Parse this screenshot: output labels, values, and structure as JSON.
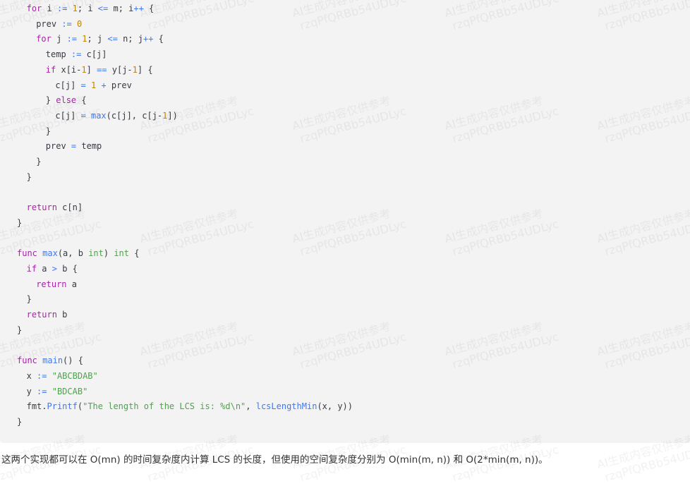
{
  "code": {
    "language": "go",
    "lines": [
      {
        "indent": 1,
        "tokens": [
          [
            "kw",
            "for"
          ],
          [
            "plain",
            " i "
          ],
          [
            "op",
            ":="
          ],
          [
            "plain",
            " "
          ],
          [
            "num",
            "1"
          ],
          [
            "plain",
            "; i "
          ],
          [
            "op",
            "<="
          ],
          [
            "plain",
            " m; i"
          ],
          [
            "op",
            "++"
          ],
          [
            "plain",
            " {"
          ]
        ]
      },
      {
        "indent": 2,
        "tokens": [
          [
            "plain",
            "prev "
          ],
          [
            "op",
            ":="
          ],
          [
            "plain",
            " "
          ],
          [
            "num",
            "0"
          ]
        ]
      },
      {
        "indent": 2,
        "tokens": [
          [
            "kw",
            "for"
          ],
          [
            "plain",
            " j "
          ],
          [
            "op",
            ":="
          ],
          [
            "plain",
            " "
          ],
          [
            "num",
            "1"
          ],
          [
            "plain",
            "; j "
          ],
          [
            "op",
            "<="
          ],
          [
            "plain",
            " n; j"
          ],
          [
            "op",
            "++"
          ],
          [
            "plain",
            " {"
          ]
        ]
      },
      {
        "indent": 3,
        "tokens": [
          [
            "plain",
            "temp "
          ],
          [
            "op",
            ":="
          ],
          [
            "plain",
            " c[j]"
          ]
        ]
      },
      {
        "indent": 3,
        "tokens": [
          [
            "kw",
            "if"
          ],
          [
            "plain",
            " x[i-"
          ],
          [
            "num",
            "1"
          ],
          [
            "plain",
            "] "
          ],
          [
            "op",
            "=="
          ],
          [
            "plain",
            " y[j-"
          ],
          [
            "num",
            "1"
          ],
          [
            "plain",
            "] {"
          ]
        ]
      },
      {
        "indent": 4,
        "tokens": [
          [
            "plain",
            "c[j] "
          ],
          [
            "op",
            "="
          ],
          [
            "plain",
            " "
          ],
          [
            "num",
            "1"
          ],
          [
            "plain",
            " "
          ],
          [
            "op",
            "+"
          ],
          [
            "plain",
            " prev"
          ]
        ]
      },
      {
        "indent": 3,
        "tokens": [
          [
            "plain",
            "} "
          ],
          [
            "kw",
            "else"
          ],
          [
            "plain",
            " {"
          ]
        ]
      },
      {
        "indent": 4,
        "tokens": [
          [
            "plain",
            "c[j] "
          ],
          [
            "op",
            "="
          ],
          [
            "plain",
            " "
          ],
          [
            "fn",
            "max"
          ],
          [
            "plain",
            "(c[j], c[j-"
          ],
          [
            "num",
            "1"
          ],
          [
            "plain",
            "])"
          ]
        ]
      },
      {
        "indent": 3,
        "tokens": [
          [
            "plain",
            "}"
          ]
        ]
      },
      {
        "indent": 3,
        "tokens": [
          [
            "plain",
            "prev "
          ],
          [
            "op",
            "="
          ],
          [
            "plain",
            " temp"
          ]
        ]
      },
      {
        "indent": 2,
        "tokens": [
          [
            "plain",
            "}"
          ]
        ]
      },
      {
        "indent": 1,
        "tokens": [
          [
            "plain",
            "}"
          ]
        ]
      },
      {
        "indent": 0,
        "tokens": []
      },
      {
        "indent": 1,
        "tokens": [
          [
            "kw",
            "return"
          ],
          [
            "plain",
            " c[n]"
          ]
        ]
      },
      {
        "indent": 0,
        "tokens": [
          [
            "plain",
            "}"
          ]
        ]
      },
      {
        "indent": 0,
        "tokens": []
      },
      {
        "indent": 0,
        "tokens": [
          [
            "kw",
            "func"
          ],
          [
            "plain",
            " "
          ],
          [
            "fn",
            "max"
          ],
          [
            "plain",
            "(a, b "
          ],
          [
            "type",
            "int"
          ],
          [
            "plain",
            ") "
          ],
          [
            "type",
            "int"
          ],
          [
            "plain",
            " {"
          ]
        ]
      },
      {
        "indent": 1,
        "tokens": [
          [
            "kw",
            "if"
          ],
          [
            "plain",
            " a "
          ],
          [
            "op",
            ">"
          ],
          [
            "plain",
            " b {"
          ]
        ]
      },
      {
        "indent": 2,
        "tokens": [
          [
            "kw",
            "return"
          ],
          [
            "plain",
            " a"
          ]
        ]
      },
      {
        "indent": 1,
        "tokens": [
          [
            "plain",
            "}"
          ]
        ]
      },
      {
        "indent": 1,
        "tokens": [
          [
            "kw",
            "return"
          ],
          [
            "plain",
            " b"
          ]
        ]
      },
      {
        "indent": 0,
        "tokens": [
          [
            "plain",
            "}"
          ]
        ]
      },
      {
        "indent": 0,
        "tokens": []
      },
      {
        "indent": 0,
        "tokens": [
          [
            "kw",
            "func"
          ],
          [
            "plain",
            " "
          ],
          [
            "fn",
            "main"
          ],
          [
            "plain",
            "() {"
          ]
        ]
      },
      {
        "indent": 1,
        "tokens": [
          [
            "plain",
            "x "
          ],
          [
            "op",
            ":="
          ],
          [
            "plain",
            " "
          ],
          [
            "str",
            "\"ABCBDAB\""
          ]
        ]
      },
      {
        "indent": 1,
        "tokens": [
          [
            "plain",
            "y "
          ],
          [
            "op",
            ":="
          ],
          [
            "plain",
            " "
          ],
          [
            "str",
            "\"BDCAB\""
          ]
        ]
      },
      {
        "indent": 1,
        "tokens": [
          [
            "plain",
            "fmt."
          ],
          [
            "fn",
            "Printf"
          ],
          [
            "plain",
            "("
          ],
          [
            "str",
            "\"The length of the LCS is: %d\\n\""
          ],
          [
            "plain",
            ", "
          ],
          [
            "fn",
            "lcsLengthMin"
          ],
          [
            "plain",
            "(x, y))"
          ]
        ]
      },
      {
        "indent": 0,
        "tokens": [
          [
            "plain",
            "}"
          ]
        ]
      }
    ]
  },
  "paragraph": {
    "text": "这两个实现都可以在 O(mn) 的时间复杂度内计算 LCS 的长度，但使用的空间复杂度分别为 O(min(m, n)) 和 O(2*min(m, n))。"
  },
  "watermark": {
    "line1": "AI生成内容仅供参考",
    "line2": "rzqPfQRBb54UDLyc"
  },
  "colors": {
    "code_background": "#f3f3f3",
    "keyword": "#a626a4",
    "operator": "#4078f2",
    "number": "#c18401",
    "type": "#50a14f",
    "string": "#50a14f",
    "text": "#383a42"
  }
}
